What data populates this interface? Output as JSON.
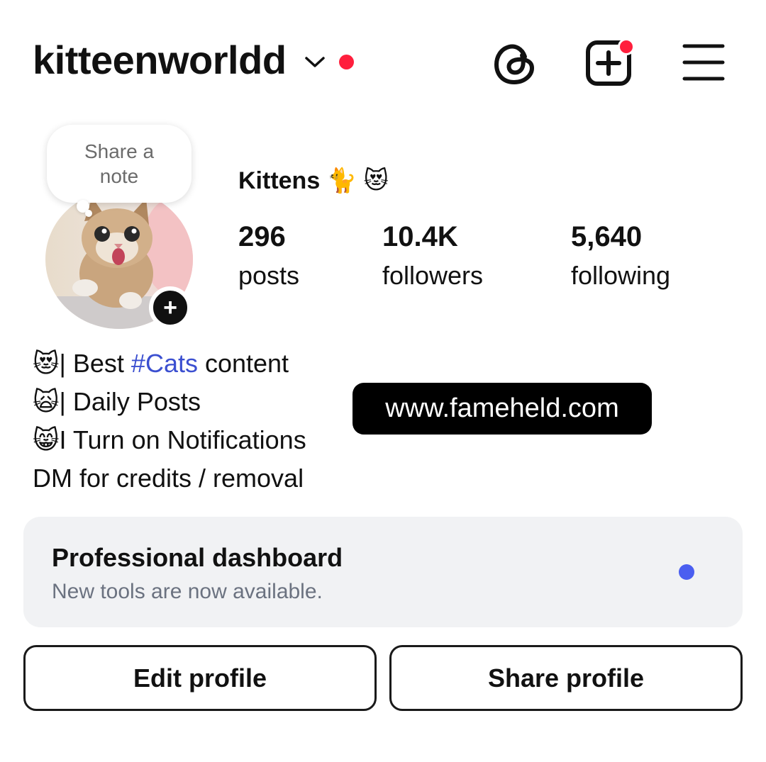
{
  "header": {
    "username": "kitteenworldd",
    "icons": [
      "chevron-down-icon",
      "notification-dot",
      "threads-icon",
      "create-icon",
      "menu-icon"
    ]
  },
  "note": {
    "placeholder": "Share a note"
  },
  "profile": {
    "display_name": "Kittens 🐈 😻",
    "stats": [
      {
        "value": "296",
        "label": "posts"
      },
      {
        "value": "10.4K",
        "label": "followers"
      },
      {
        "value": "5,640",
        "label": "following"
      }
    ]
  },
  "bio": {
    "line1_emoji": "😻",
    "line1_pre": "| Best ",
    "line1_hashtag": "#Cats",
    "line1_post": " content",
    "line2_emoji": "🙀",
    "line2_text": "| Daily Posts",
    "line3_emoji": "😸",
    "line3_text": "I Turn on Notifications",
    "line4_text": "DM for credits / removal"
  },
  "link": {
    "label": "www.fameheld.com"
  },
  "dashboard": {
    "title": "Professional dashboard",
    "subtitle": "New tools are now available."
  },
  "buttons": {
    "edit": "Edit profile",
    "share": "Share profile"
  },
  "colors": {
    "notification_red": "#ff1f3d",
    "hashtag_blue": "#3b4fd0",
    "dashboard_dot": "#4a5ef0",
    "card_bg": "#f1f2f4"
  }
}
